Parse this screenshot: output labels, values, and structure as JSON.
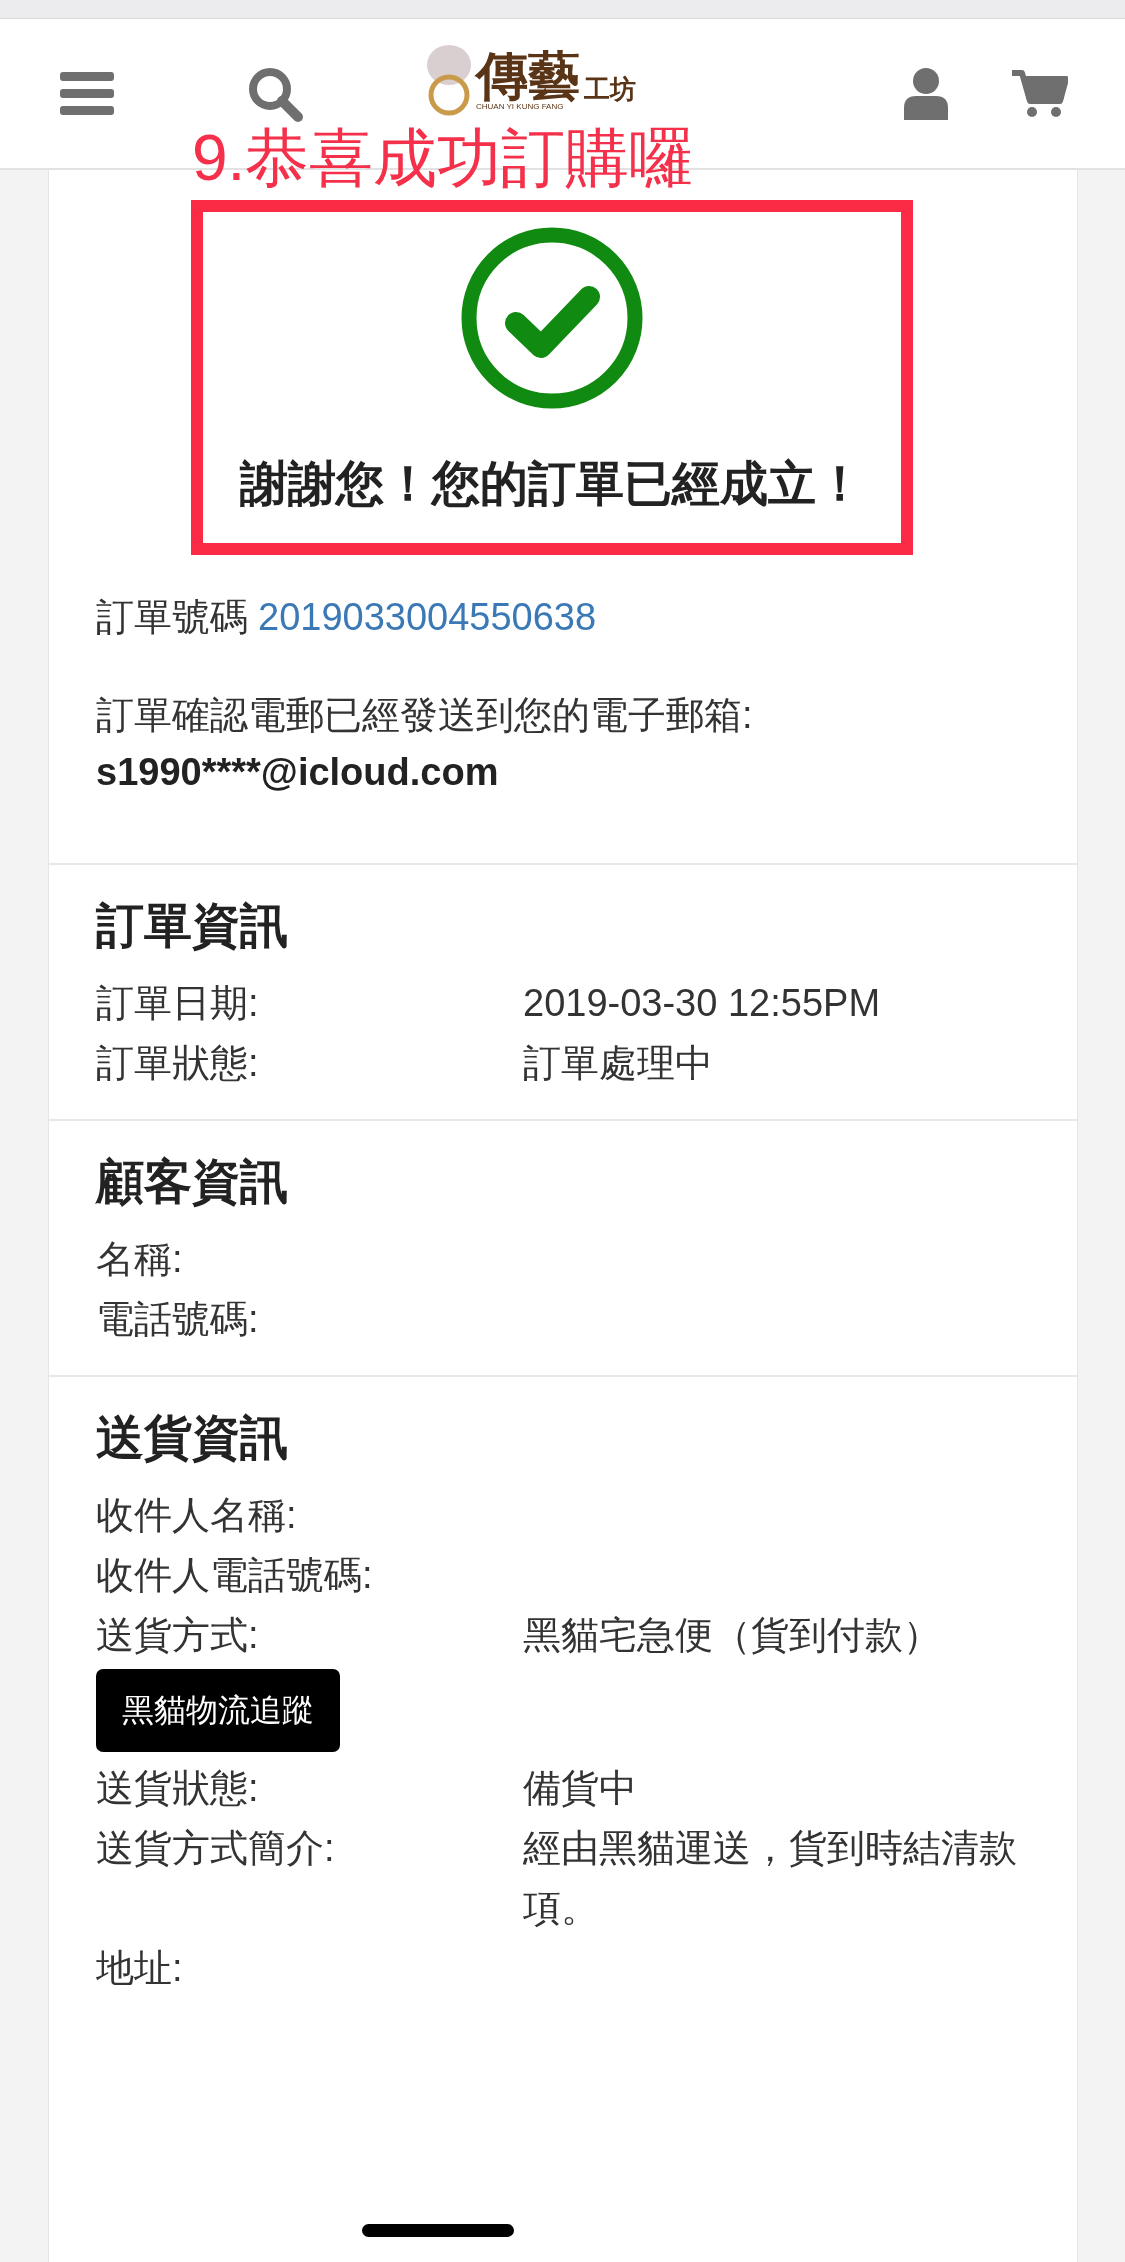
{
  "header": {
    "logo": {
      "main": "傳藝",
      "suffix": "工坊",
      "subtitle": "CHUAN YI KUNG FANG"
    }
  },
  "annotation": "9.恭喜成功訂購囉",
  "success": {
    "message": "謝謝您！您的訂單已經成立！"
  },
  "order_number": {
    "label": "訂單號碼",
    "value": "2019033004550638"
  },
  "email_notice": {
    "text": "訂單確認電郵已經發送到您的電子郵箱:",
    "email": "s1990****@icloud.com"
  },
  "sections": [
    {
      "title": "訂單資訊",
      "rows": [
        {
          "kind": "field",
          "label": "訂單日期:",
          "value": "2019-03-30 12:55PM"
        },
        {
          "kind": "field",
          "label": "訂單狀態:",
          "value": "訂單處理中"
        }
      ]
    },
    {
      "title": "顧客資訊",
      "rows": [
        {
          "kind": "field",
          "label": "名稱:"
        },
        {
          "kind": "field",
          "label": "電話號碼:"
        }
      ]
    },
    {
      "title": "送貨資訊",
      "rows": [
        {
          "kind": "field",
          "label": "收件人名稱:"
        },
        {
          "kind": "field",
          "label": "收件人電話號碼:"
        },
        {
          "kind": "field",
          "label": "送貨方式:",
          "value": "黑貓宅急便（貨到付款）"
        },
        {
          "kind": "button",
          "label": "黑貓物流追蹤"
        },
        {
          "kind": "field",
          "label": "送貨狀態:",
          "value": "備貨中"
        },
        {
          "kind": "field",
          "label": "送貨方式簡介:",
          "value": "經由黑貓運送，貨到時結清款項。"
        },
        {
          "kind": "field",
          "label": "地址:"
        }
      ]
    }
  ]
}
